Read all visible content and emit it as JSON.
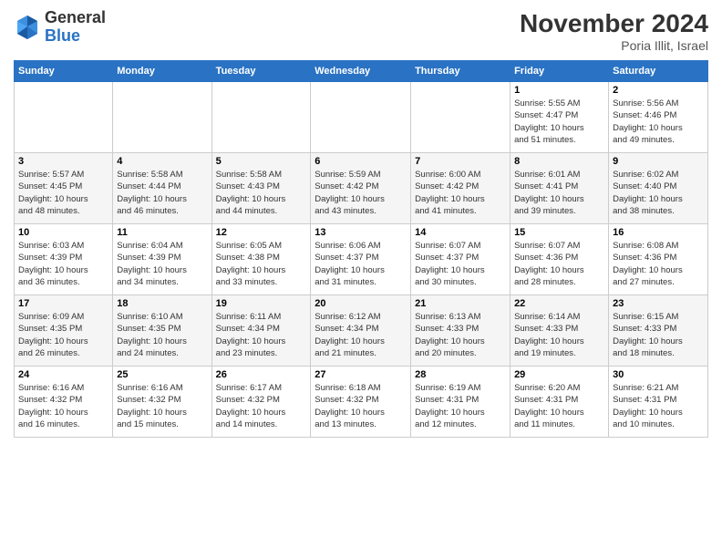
{
  "header": {
    "logo_general": "General",
    "logo_blue": "Blue",
    "month_title": "November 2024",
    "location": "Poria Illit, Israel"
  },
  "weekdays": [
    "Sunday",
    "Monday",
    "Tuesday",
    "Wednesday",
    "Thursday",
    "Friday",
    "Saturday"
  ],
  "weeks": [
    [
      {
        "day": "",
        "info": ""
      },
      {
        "day": "",
        "info": ""
      },
      {
        "day": "",
        "info": ""
      },
      {
        "day": "",
        "info": ""
      },
      {
        "day": "",
        "info": ""
      },
      {
        "day": "1",
        "info": "Sunrise: 5:55 AM\nSunset: 4:47 PM\nDaylight: 10 hours\nand 51 minutes."
      },
      {
        "day": "2",
        "info": "Sunrise: 5:56 AM\nSunset: 4:46 PM\nDaylight: 10 hours\nand 49 minutes."
      }
    ],
    [
      {
        "day": "3",
        "info": "Sunrise: 5:57 AM\nSunset: 4:45 PM\nDaylight: 10 hours\nand 48 minutes."
      },
      {
        "day": "4",
        "info": "Sunrise: 5:58 AM\nSunset: 4:44 PM\nDaylight: 10 hours\nand 46 minutes."
      },
      {
        "day": "5",
        "info": "Sunrise: 5:58 AM\nSunset: 4:43 PM\nDaylight: 10 hours\nand 44 minutes."
      },
      {
        "day": "6",
        "info": "Sunrise: 5:59 AM\nSunset: 4:42 PM\nDaylight: 10 hours\nand 43 minutes."
      },
      {
        "day": "7",
        "info": "Sunrise: 6:00 AM\nSunset: 4:42 PM\nDaylight: 10 hours\nand 41 minutes."
      },
      {
        "day": "8",
        "info": "Sunrise: 6:01 AM\nSunset: 4:41 PM\nDaylight: 10 hours\nand 39 minutes."
      },
      {
        "day": "9",
        "info": "Sunrise: 6:02 AM\nSunset: 4:40 PM\nDaylight: 10 hours\nand 38 minutes."
      }
    ],
    [
      {
        "day": "10",
        "info": "Sunrise: 6:03 AM\nSunset: 4:39 PM\nDaylight: 10 hours\nand 36 minutes."
      },
      {
        "day": "11",
        "info": "Sunrise: 6:04 AM\nSunset: 4:39 PM\nDaylight: 10 hours\nand 34 minutes."
      },
      {
        "day": "12",
        "info": "Sunrise: 6:05 AM\nSunset: 4:38 PM\nDaylight: 10 hours\nand 33 minutes."
      },
      {
        "day": "13",
        "info": "Sunrise: 6:06 AM\nSunset: 4:37 PM\nDaylight: 10 hours\nand 31 minutes."
      },
      {
        "day": "14",
        "info": "Sunrise: 6:07 AM\nSunset: 4:37 PM\nDaylight: 10 hours\nand 30 minutes."
      },
      {
        "day": "15",
        "info": "Sunrise: 6:07 AM\nSunset: 4:36 PM\nDaylight: 10 hours\nand 28 minutes."
      },
      {
        "day": "16",
        "info": "Sunrise: 6:08 AM\nSunset: 4:36 PM\nDaylight: 10 hours\nand 27 minutes."
      }
    ],
    [
      {
        "day": "17",
        "info": "Sunrise: 6:09 AM\nSunset: 4:35 PM\nDaylight: 10 hours\nand 26 minutes."
      },
      {
        "day": "18",
        "info": "Sunrise: 6:10 AM\nSunset: 4:35 PM\nDaylight: 10 hours\nand 24 minutes."
      },
      {
        "day": "19",
        "info": "Sunrise: 6:11 AM\nSunset: 4:34 PM\nDaylight: 10 hours\nand 23 minutes."
      },
      {
        "day": "20",
        "info": "Sunrise: 6:12 AM\nSunset: 4:34 PM\nDaylight: 10 hours\nand 21 minutes."
      },
      {
        "day": "21",
        "info": "Sunrise: 6:13 AM\nSunset: 4:33 PM\nDaylight: 10 hours\nand 20 minutes."
      },
      {
        "day": "22",
        "info": "Sunrise: 6:14 AM\nSunset: 4:33 PM\nDaylight: 10 hours\nand 19 minutes."
      },
      {
        "day": "23",
        "info": "Sunrise: 6:15 AM\nSunset: 4:33 PM\nDaylight: 10 hours\nand 18 minutes."
      }
    ],
    [
      {
        "day": "24",
        "info": "Sunrise: 6:16 AM\nSunset: 4:32 PM\nDaylight: 10 hours\nand 16 minutes."
      },
      {
        "day": "25",
        "info": "Sunrise: 6:16 AM\nSunset: 4:32 PM\nDaylight: 10 hours\nand 15 minutes."
      },
      {
        "day": "26",
        "info": "Sunrise: 6:17 AM\nSunset: 4:32 PM\nDaylight: 10 hours\nand 14 minutes."
      },
      {
        "day": "27",
        "info": "Sunrise: 6:18 AM\nSunset: 4:32 PM\nDaylight: 10 hours\nand 13 minutes."
      },
      {
        "day": "28",
        "info": "Sunrise: 6:19 AM\nSunset: 4:31 PM\nDaylight: 10 hours\nand 12 minutes."
      },
      {
        "day": "29",
        "info": "Sunrise: 6:20 AM\nSunset: 4:31 PM\nDaylight: 10 hours\nand 11 minutes."
      },
      {
        "day": "30",
        "info": "Sunrise: 6:21 AM\nSunset: 4:31 PM\nDaylight: 10 hours\nand 10 minutes."
      }
    ]
  ]
}
